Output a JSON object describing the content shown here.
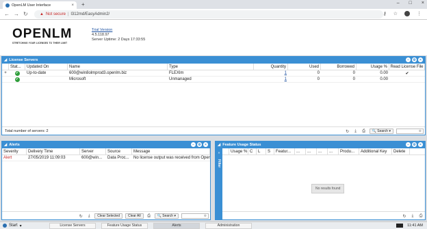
{
  "browser": {
    "tab_title": "OpenLM User Interface",
    "tab_close": "×",
    "new_tab": "+",
    "win_min": "–",
    "win_max": "□",
    "win_close": "×",
    "security_label": "Not secure",
    "url": "l312md/EasyAdmin2/"
  },
  "header": {
    "logo_text": "OPENLM",
    "tagline": "STRETCHING YOUR LICENSES TO THEIR LIMIT",
    "trial": "Trial Version",
    "version": "4.5.118.97",
    "uptime": "Server Uptime: 2 Days 17:33:55"
  },
  "license_servers": {
    "title": "License Servers",
    "columns": [
      "Stat...",
      "Updated On",
      "Name",
      "Type",
      "Quantity",
      "Used",
      "Borrowed",
      "Usage %",
      "Read License File"
    ],
    "rows": [
      {
        "expand": "+",
        "updated": "Up-to-date",
        "name": "600@win8olmprod3.openlm.biz",
        "type": "FLEXlm",
        "quantity": "1",
        "used": "0",
        "borrowed": "0",
        "usage": "0.00",
        "read": "✔"
      },
      {
        "expand": "",
        "updated": "",
        "name": "Microsoft",
        "type": "Unmanaged",
        "quantity": "1",
        "used": "0",
        "borrowed": "0",
        "usage": "0.00",
        "read": ""
      }
    ],
    "footer": "Total number of servers: 2",
    "search": "Search"
  },
  "alerts": {
    "title": "Alerts",
    "columns": [
      "Severity",
      "Delivery Time",
      "Server",
      "Source",
      "Message"
    ],
    "rows": [
      {
        "severity": "Alert",
        "time": "27/05/2019 11:09:03",
        "server": "600@win...",
        "source": "Data Proc...",
        "message": "No license output was received from Open..."
      }
    ],
    "clear_selected": "Clear Selected",
    "clear_all": "Clear All",
    "search": "Search"
  },
  "feature_usage": {
    "title": "Feature Usage Status",
    "filter": "Filter",
    "columns": [
      "Usage %",
      "C",
      "L",
      "S",
      "Featur...",
      "...",
      "...",
      "...",
      "...",
      "Produ...",
      "Additional Key",
      "Delete"
    ],
    "no_results": "No results found"
  },
  "taskbar": {
    "start": "Start",
    "items": [
      "License Servers",
      "Feature Usage Status",
      "Alerts",
      "Administration"
    ],
    "active": "Alerts",
    "time": "11:41 AM"
  }
}
